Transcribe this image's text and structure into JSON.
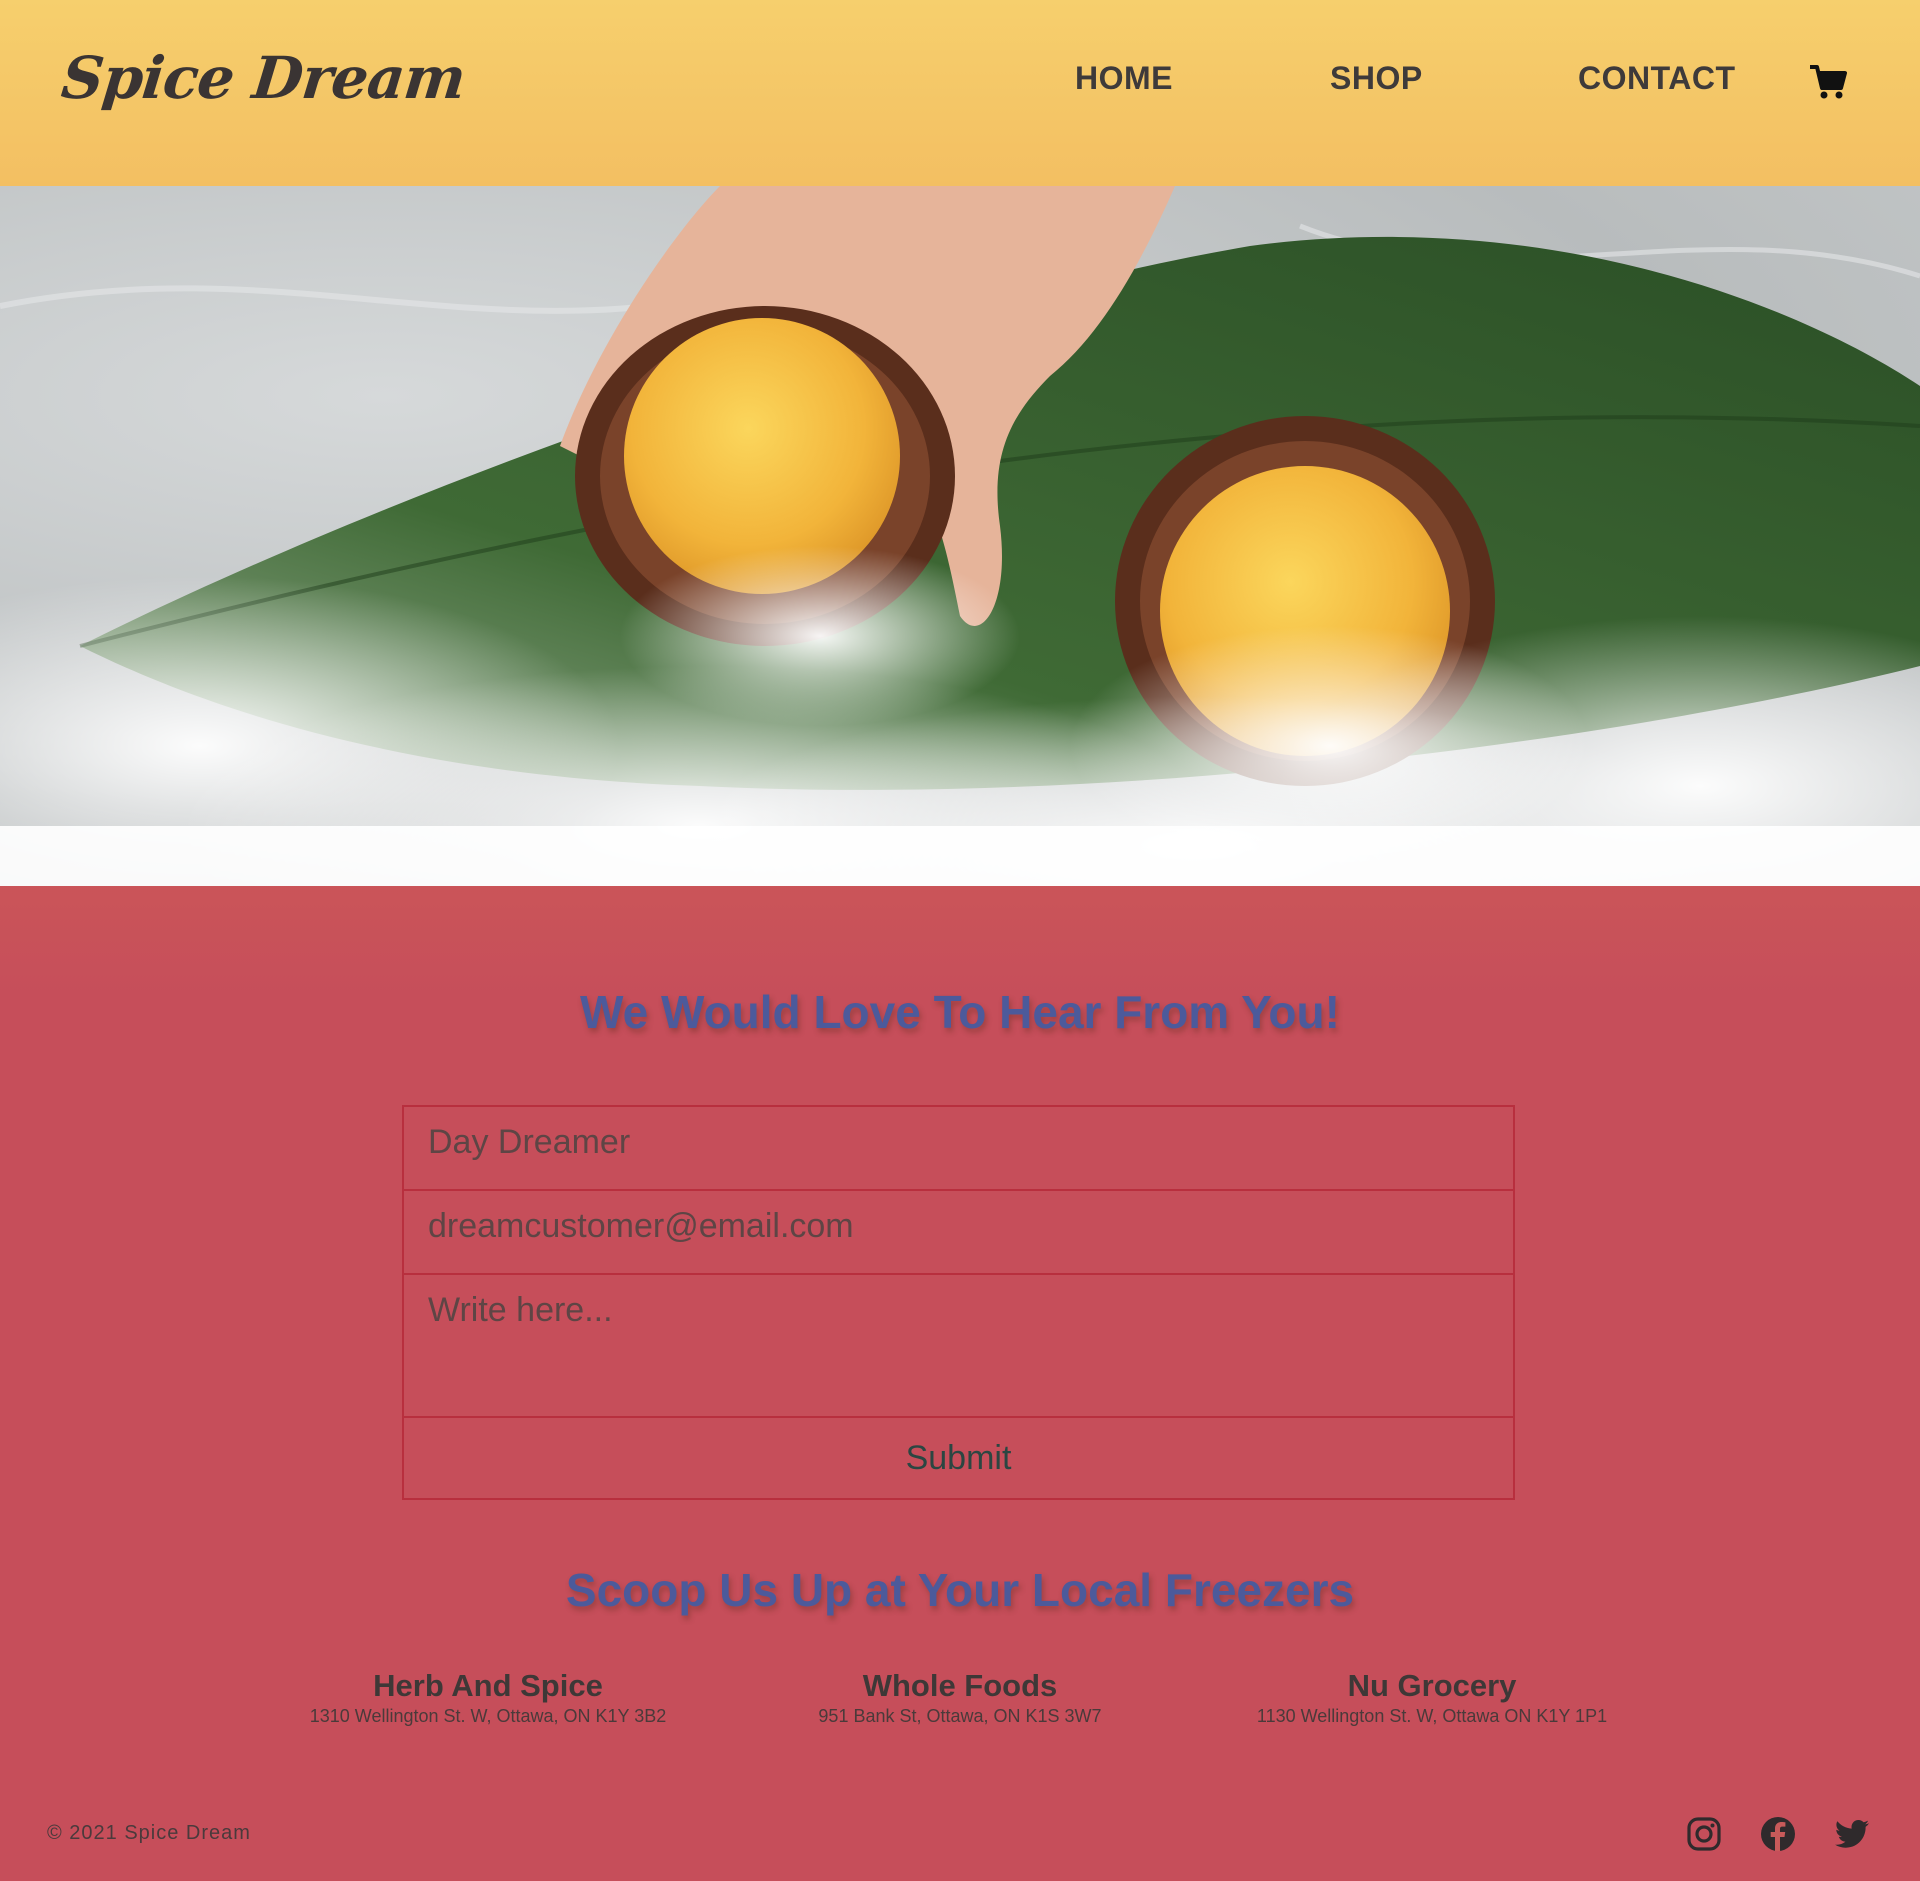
{
  "brand": {
    "name": "Spice Dream"
  },
  "nav": {
    "items": [
      {
        "label": "HOME"
      },
      {
        "label": "SHOP"
      },
      {
        "label": "CONTACT"
      }
    ],
    "cart_icon": "shopping-cart-icon"
  },
  "hero": {
    "image": "coconut-sorbet-on-leaf-photo"
  },
  "contact": {
    "title": "We Would Love To Hear From You!",
    "name_value": "Day Dreamer",
    "email_value": "dreamcustomer@email.com",
    "message_placeholder": "Write here...",
    "submit_label": "Submit"
  },
  "stores": {
    "title": "Scoop Us Up at Your Local Freezers",
    "items": [
      {
        "name": "Herb And Spice",
        "address": "1310 Wellington St. W, Ottawa, ON K1Y 3B2"
      },
      {
        "name": "Whole Foods",
        "address": "951 Bank St, Ottawa, ON K1S 3W7"
      },
      {
        "name": "Nu Grocery",
        "address": "1130 Wellington St. W, Ottawa ON K1Y 1P1"
      }
    ]
  },
  "footer": {
    "copyright": "© 2021 Spice Dream",
    "social": [
      "instagram-icon",
      "facebook-icon",
      "twitter-icon"
    ]
  },
  "colors": {
    "header_bg": "#f6cf6d",
    "heading": "#4c5a9b",
    "form_border": "#b82f3e"
  }
}
